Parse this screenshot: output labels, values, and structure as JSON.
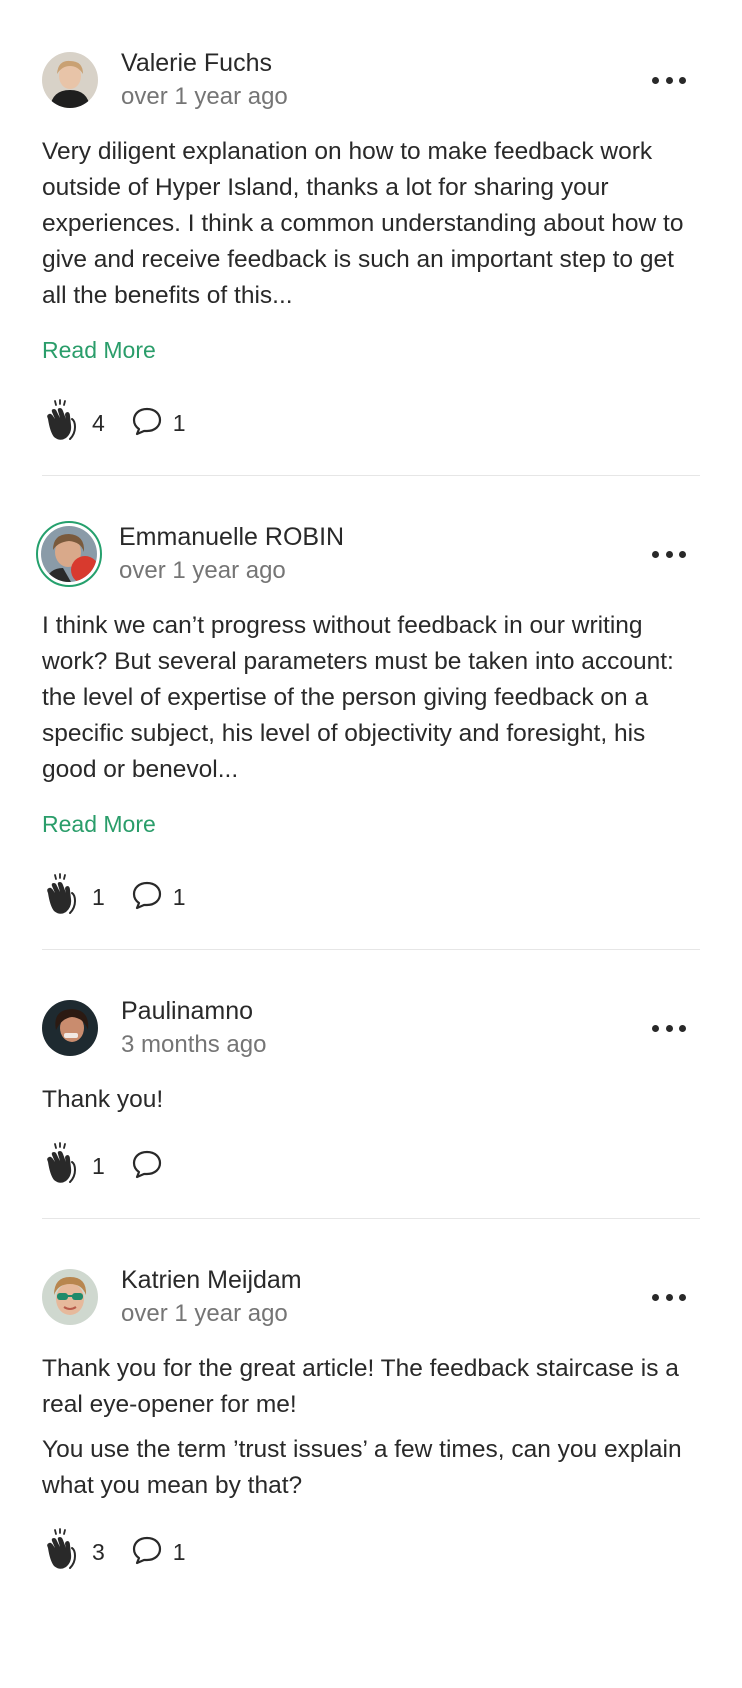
{
  "comments": [
    {
      "author": "Valerie Fuchs",
      "time": "over 1 year ago",
      "paragraphs": [
        "Very diligent explanation on how to make feedback work outside of Hyper Island, thanks a lot for sharing your experiences. I think a common understanding about how to give and receive feedback is such an important step to get all the benefits of this..."
      ],
      "read_more": "Read More",
      "claps": "4",
      "replies": "1"
    },
    {
      "author": "Emmanuelle ROBIN",
      "time": "over 1 year ago",
      "paragraphs": [
        "I think we can’t progress without feedback in our writing work? But several parameters must be taken into account: the level of expertise of the person giving feedback on a specific subject, his level of objectivity and foresight, his good or benevol..."
      ],
      "read_more": "Read More",
      "claps": "1",
      "replies": "1"
    },
    {
      "author": "Paulinamno",
      "time": "3 months ago",
      "paragraphs": [
        "Thank you!"
      ],
      "claps": "1",
      "replies": ""
    },
    {
      "author": "Katrien Meijdam",
      "time": "over 1 year ago",
      "paragraphs": [
        "Thank you for the great article! The feedback staircase is a real eye-opener for me!",
        "You use the term ’trust issues’ a few times, can you explain what you mean by that?"
      ],
      "claps": "3",
      "replies": "1"
    }
  ],
  "icons": {
    "more": "more-options-icon",
    "clap": "clap-icon",
    "reply": "speech-bubble-icon"
  },
  "colors": {
    "accent": "#2a9d6a",
    "text": "#292929",
    "muted": "#757575",
    "divider": "#e6e6e6"
  }
}
